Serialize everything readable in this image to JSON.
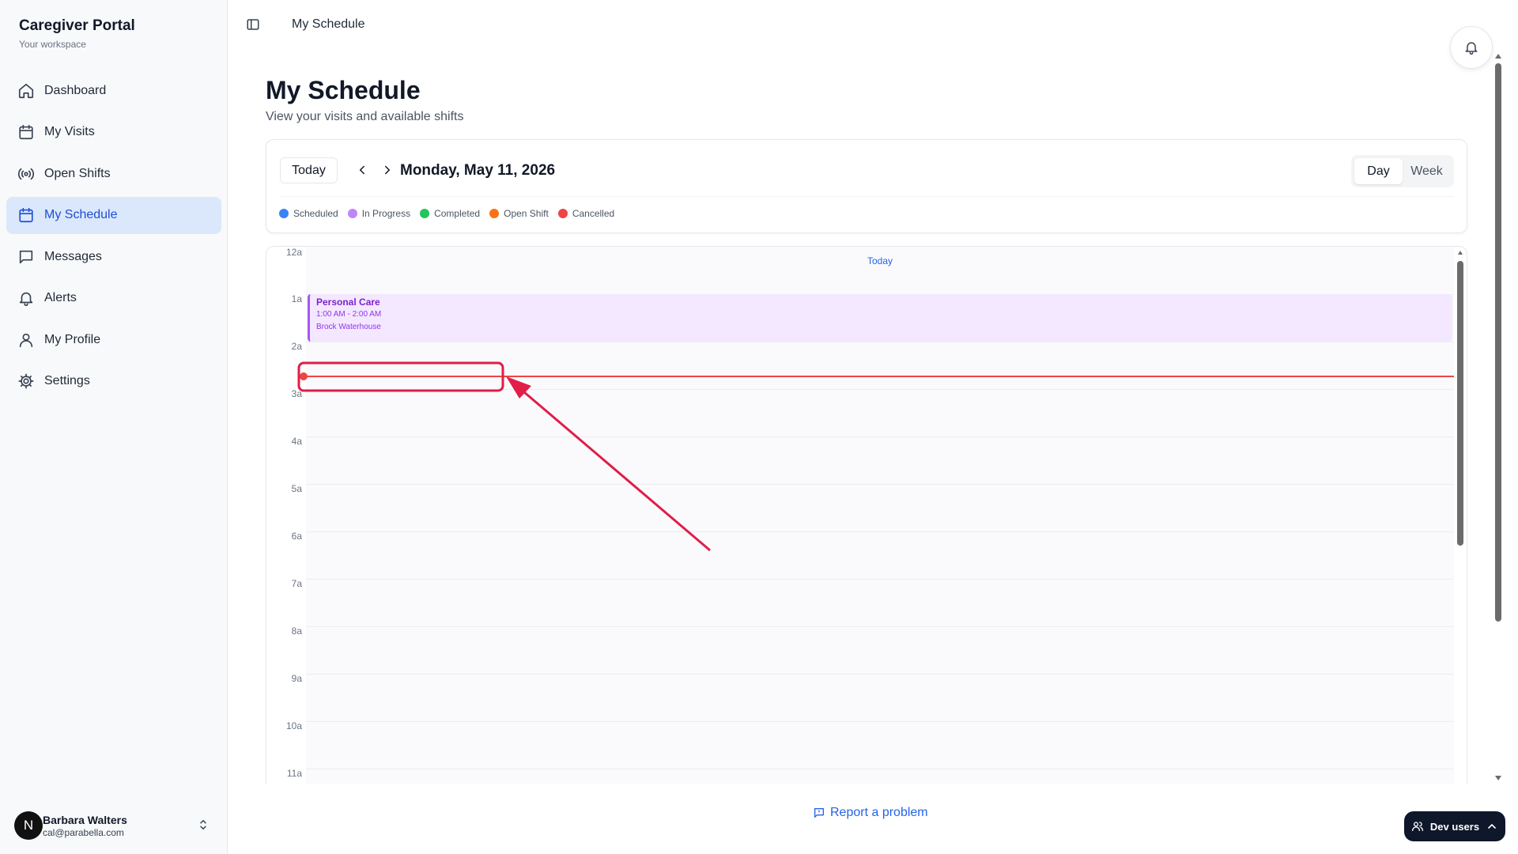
{
  "sidebar": {
    "brand_title": "Caregiver Portal",
    "brand_subtitle": "Your workspace",
    "items": [
      {
        "label": "Dashboard",
        "icon": "home-icon"
      },
      {
        "label": "My Visits",
        "icon": "calendar-icon"
      },
      {
        "label": "Open Shifts",
        "icon": "radio-icon"
      },
      {
        "label": "My Schedule",
        "icon": "calendar-icon",
        "active": true
      },
      {
        "label": "Messages",
        "icon": "message-icon"
      },
      {
        "label": "Alerts",
        "icon": "bell-icon"
      },
      {
        "label": "My Profile",
        "icon": "user-icon"
      },
      {
        "label": "Settings",
        "icon": "gear-icon"
      }
    ],
    "user": {
      "initial": "N",
      "name": "Barbara Walters",
      "email": "cal@parabella.com"
    }
  },
  "topbar": {
    "breadcrumb": "My Schedule"
  },
  "main": {
    "title": "My Schedule",
    "subtitle": "View your visits and available shifts",
    "toolbar": {
      "today_label": "Today",
      "date": "Monday, May 11, 2026",
      "views": [
        "Day",
        "Week"
      ],
      "active_view": "Day"
    },
    "legend": [
      {
        "label": "Scheduled",
        "color": "#3b82f6"
      },
      {
        "label": "In Progress",
        "color": "#c084fc"
      },
      {
        "label": "Completed",
        "color": "#22c55e"
      },
      {
        "label": "Open Shift",
        "color": "#f97316"
      },
      {
        "label": "Cancelled",
        "color": "#ef4444"
      }
    ]
  },
  "calendar": {
    "column_header": "Today",
    "hours": [
      "12a",
      "1a",
      "2a",
      "3a",
      "4a",
      "5a",
      "6a",
      "7a",
      "8a",
      "9a",
      "10a",
      "11a"
    ],
    "events": [
      {
        "title": "Personal Care",
        "time": "1:00 AM - 2:00 AM",
        "client": "Brock Waterhouse",
        "status": "In Progress"
      }
    ],
    "now_indicator_color": "#ef4444"
  },
  "footer": {
    "report_label": "Report a problem",
    "dev_users_label": "Dev users"
  },
  "colors": {
    "accent": "#2563eb",
    "active_nav_bg": "#dbe7fb",
    "annotation": "#e11d48"
  }
}
